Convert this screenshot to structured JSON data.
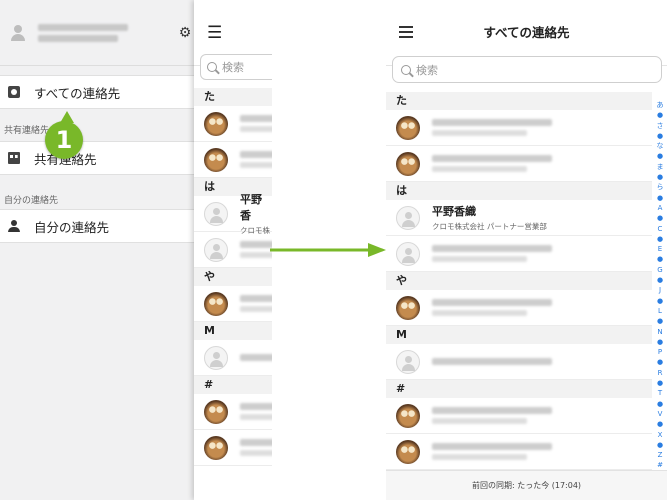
{
  "sidebar": {
    "gear": "⚙",
    "all_contacts": "すべての連絡先",
    "shared_section": "共有連絡先",
    "shared_item": "共有連絡先",
    "mine_section": "自分の連絡先",
    "mine_item": "自分の連絡先"
  },
  "callout": {
    "number": "1"
  },
  "list": {
    "menu": "☰",
    "title": "すべての連絡先",
    "search_placeholder": "検索",
    "sections": {
      "ta": "た",
      "ha": "は",
      "ya": "や",
      "m": "M",
      "hash": "#"
    },
    "featured_contact": {
      "name": "平野香織",
      "company": "クロモ株式会社 パートナー営業部"
    },
    "partial_contact": {
      "name": "平野香",
      "company": "クロモ株"
    }
  },
  "index_bar": [
    "あ",
    "●",
    "さ",
    "●",
    "な",
    "●",
    "ま",
    "●",
    "ら",
    "●",
    "A",
    "●",
    "C",
    "●",
    "E",
    "●",
    "G",
    "●",
    "J",
    "●",
    "L",
    "●",
    "N",
    "●",
    "P",
    "●",
    "R",
    "●",
    "T",
    "●",
    "V",
    "●",
    "X",
    "●",
    "Z",
    "#"
  ],
  "footer": {
    "sync": "前回の同期: たった今 (17:04)"
  },
  "colors": {
    "accent": "#79b829",
    "index": "#2a7de1"
  }
}
